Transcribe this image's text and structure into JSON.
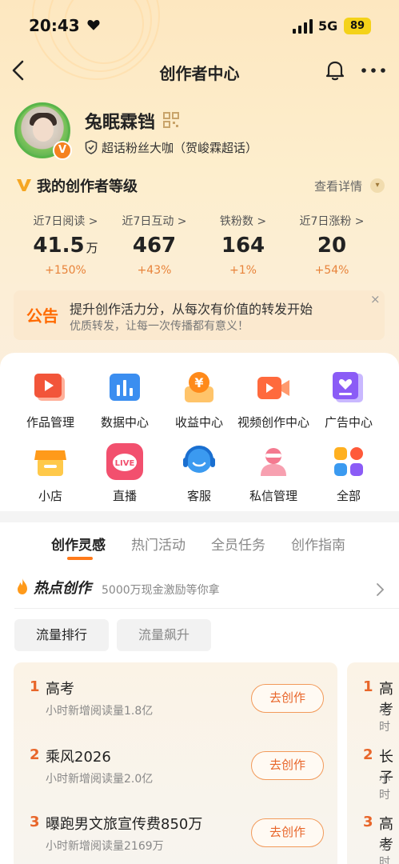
{
  "status": {
    "time": "20:43",
    "network": "5G",
    "battery": "89"
  },
  "nav": {
    "title": "创作者中心"
  },
  "profile": {
    "username": "兔眠霖铛",
    "fan_title": "超话粉丝大咖（贺峻霖超话）",
    "verified_badge": "V"
  },
  "level": {
    "title": "我的创作者等级",
    "detail": "查看详情"
  },
  "stats": [
    {
      "label": "近7日阅读 >",
      "value": "41.5",
      "unit": "万",
      "change": "+150%"
    },
    {
      "label": "近7日互动 >",
      "value": "467",
      "unit": "",
      "change": "+43%"
    },
    {
      "label": "铁粉数 >",
      "value": "164",
      "unit": "",
      "change": "+1%"
    },
    {
      "label": "近7日涨粉 >",
      "value": "20",
      "unit": "",
      "change": "+54%"
    }
  ],
  "notice": {
    "tag": "公告",
    "line1": "提升创作活力分，从每次有价值的转发开始",
    "line2": "优质转发，让每一次传播都有意义！",
    "close": "×"
  },
  "tools": [
    {
      "label": "作品管理",
      "icon": "works-icon"
    },
    {
      "label": "数据中心",
      "icon": "data-icon"
    },
    {
      "label": "收益中心",
      "icon": "income-icon"
    },
    {
      "label": "视频创作中心",
      "icon": "video-icon"
    },
    {
      "label": "广告中心",
      "icon": "ad-icon"
    },
    {
      "label": "小店",
      "icon": "shop-icon"
    },
    {
      "label": "直播",
      "icon": "live-icon"
    },
    {
      "label": "客服",
      "icon": "service-icon"
    },
    {
      "label": "私信管理",
      "icon": "message-icon"
    },
    {
      "label": "全部",
      "icon": "all-icon"
    }
  ],
  "live_icon_text": "LIVE",
  "income_icon_text": "¥",
  "tabs": [
    "创作灵感",
    "热门活动",
    "全员任务",
    "创作指南"
  ],
  "hot": {
    "title": "热点创作",
    "subtitle": "5000万现金激励等你拿"
  },
  "chips": [
    "流量排行",
    "流量飙升"
  ],
  "hot_list": [
    {
      "rank": "1",
      "title": "高考",
      "sub": "小时新增阅读量1.8亿",
      "button": "去创作"
    },
    {
      "rank": "2",
      "title": "乘风2026",
      "sub": "小时新增阅读量2.0亿",
      "button": "去创作"
    },
    {
      "rank": "3",
      "title": "曝跑男文旅宣传费850万",
      "sub": "小时新增阅读量2169万",
      "button": "去创作"
    }
  ],
  "hot_list_peek": [
    {
      "rank": "1",
      "title": "高考",
      "sub": "小时"
    },
    {
      "rank": "2",
      "title": "长子",
      "sub": "小时"
    },
    {
      "rank": "3",
      "title": "高考",
      "sub": "小时"
    }
  ],
  "colors": {
    "accent": "#ff7a1a",
    "rank": "#e8662a",
    "change": "#e8833a",
    "live_pink": "#f2506e"
  }
}
